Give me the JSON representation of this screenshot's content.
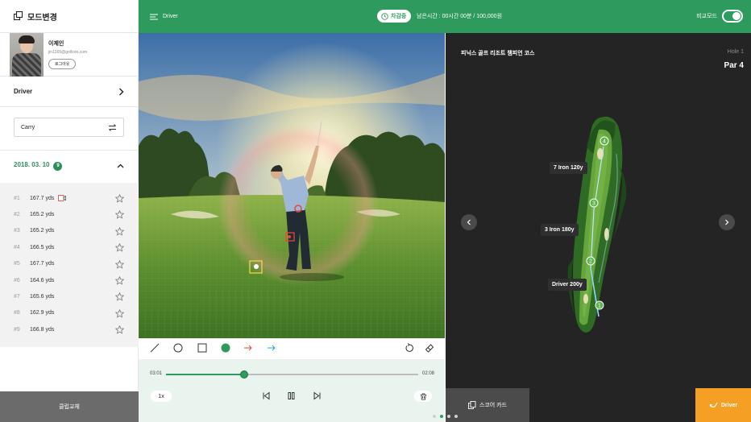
{
  "sidebar": {
    "title": "모드변경",
    "profile": {
      "name": "이제인",
      "email": "jin1265@golfzon.com",
      "logout_label": "로그아웃"
    },
    "club": "Driver",
    "carry_label": "Carry",
    "date": "2018. 03. 10",
    "date_count": "9",
    "shots": [
      {
        "no": "#1",
        "dist": "167.7 yds",
        "video": true
      },
      {
        "no": "#2",
        "dist": "165.2 yds"
      },
      {
        "no": "#3",
        "dist": "165.2 yds"
      },
      {
        "no": "#4",
        "dist": "166.5 yds"
      },
      {
        "no": "#5",
        "dist": "167.7 yds"
      },
      {
        "no": "#6",
        "dist": "164.6 yds"
      },
      {
        "no": "#7",
        "dist": "165.6 yds"
      },
      {
        "no": "#8",
        "dist": "162.9 yds"
      },
      {
        "no": "#9",
        "dist": "166.8 yds"
      }
    ],
    "switch_button": "클럽교체"
  },
  "topbar": {
    "title": "Driver",
    "pill_label": "차감중",
    "remaining": "남은시간 : 00시간 00분 / 100,000원",
    "compare_label": "비교모드"
  },
  "player": {
    "current_time": "03:01",
    "total_time": "02:08",
    "progress": 0.31,
    "speed": "1x"
  },
  "tools": {
    "colors": {
      "green": "#2e9a5e",
      "red": "#e5473b",
      "blue": "#27a0d8"
    }
  },
  "course": {
    "name": "피닉스 골프 리조트 챔피언 코스",
    "hole": "Hole 1",
    "par": "Par 4",
    "labels": {
      "iron7": "7 Iron 120y",
      "iron3": "3 Iron 180y",
      "driver": "Driver 200y"
    },
    "markers": [
      "1",
      "2",
      "3",
      "4"
    ],
    "scorecard_button": "스코어 카드",
    "driver_button": "Driver"
  },
  "colors": {
    "brand": "#2e9a5e",
    "accent": "#f5a024"
  }
}
